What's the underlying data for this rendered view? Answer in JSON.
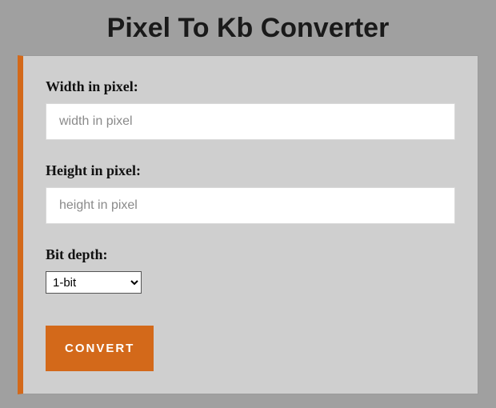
{
  "page": {
    "title": "Pixel To Kb Converter"
  },
  "form": {
    "width": {
      "label": "Width in pixel:",
      "placeholder": "width in pixel",
      "value": ""
    },
    "height": {
      "label": "Height in pixel:",
      "placeholder": "height in pixel",
      "value": ""
    },
    "bitdepth": {
      "label": "Bit depth:",
      "selected": "1-bit"
    },
    "submit_label": "CONVERT"
  },
  "colors": {
    "accent": "#d3691a",
    "card_bg": "#cfcfcf",
    "page_bg": "#a0a0a0"
  }
}
